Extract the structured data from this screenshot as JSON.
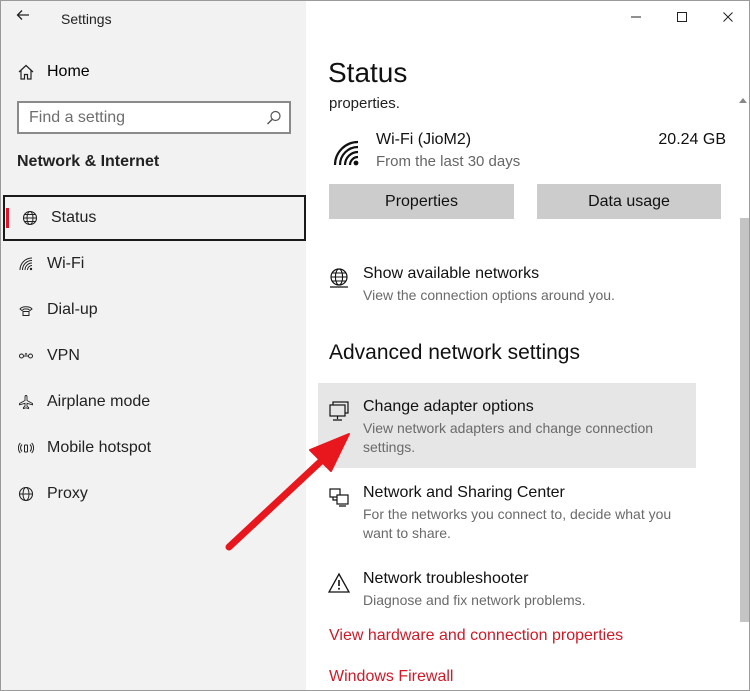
{
  "window": {
    "title": "Settings"
  },
  "sidebar": {
    "home_label": "Home",
    "search_placeholder": "Find a setting",
    "section_title": "Network & Internet",
    "items": [
      {
        "label": "Status",
        "icon": "globe-icon",
        "active": true
      },
      {
        "label": "Wi-Fi",
        "icon": "wifi-icon"
      },
      {
        "label": "Dial-up",
        "icon": "dialup-icon"
      },
      {
        "label": "VPN",
        "icon": "vpn-icon"
      },
      {
        "label": "Airplane mode",
        "icon": "airplane-icon"
      },
      {
        "label": "Mobile hotspot",
        "icon": "hotspot-icon"
      },
      {
        "label": "Proxy",
        "icon": "globe-icon"
      }
    ]
  },
  "main": {
    "title": "Status",
    "clipped_text": "properties.",
    "connection": {
      "name": "Wi-Fi (JioM2)",
      "subtitle": "From the last 30 days",
      "usage": "20.24 GB"
    },
    "buttons": {
      "properties": "Properties",
      "data_usage": "Data usage"
    },
    "show_networks": {
      "title": "Show available networks",
      "description": "View the connection options around you."
    },
    "advanced_title": "Advanced network settings",
    "adapter": {
      "title": "Change adapter options",
      "description": "View network adapters and change connection settings."
    },
    "sharing": {
      "title": "Network and Sharing Center",
      "description": "For the networks you connect to, decide what you want to share."
    },
    "troubleshooter": {
      "title": "Network troubleshooter",
      "description": "Diagnose and fix network problems."
    },
    "links": {
      "hardware": "View hardware and connection properties",
      "firewall": "Windows Firewall"
    }
  },
  "colors": {
    "accent": "#e81123",
    "link": "#d41725",
    "annotation_arrow": "#e8161d"
  }
}
